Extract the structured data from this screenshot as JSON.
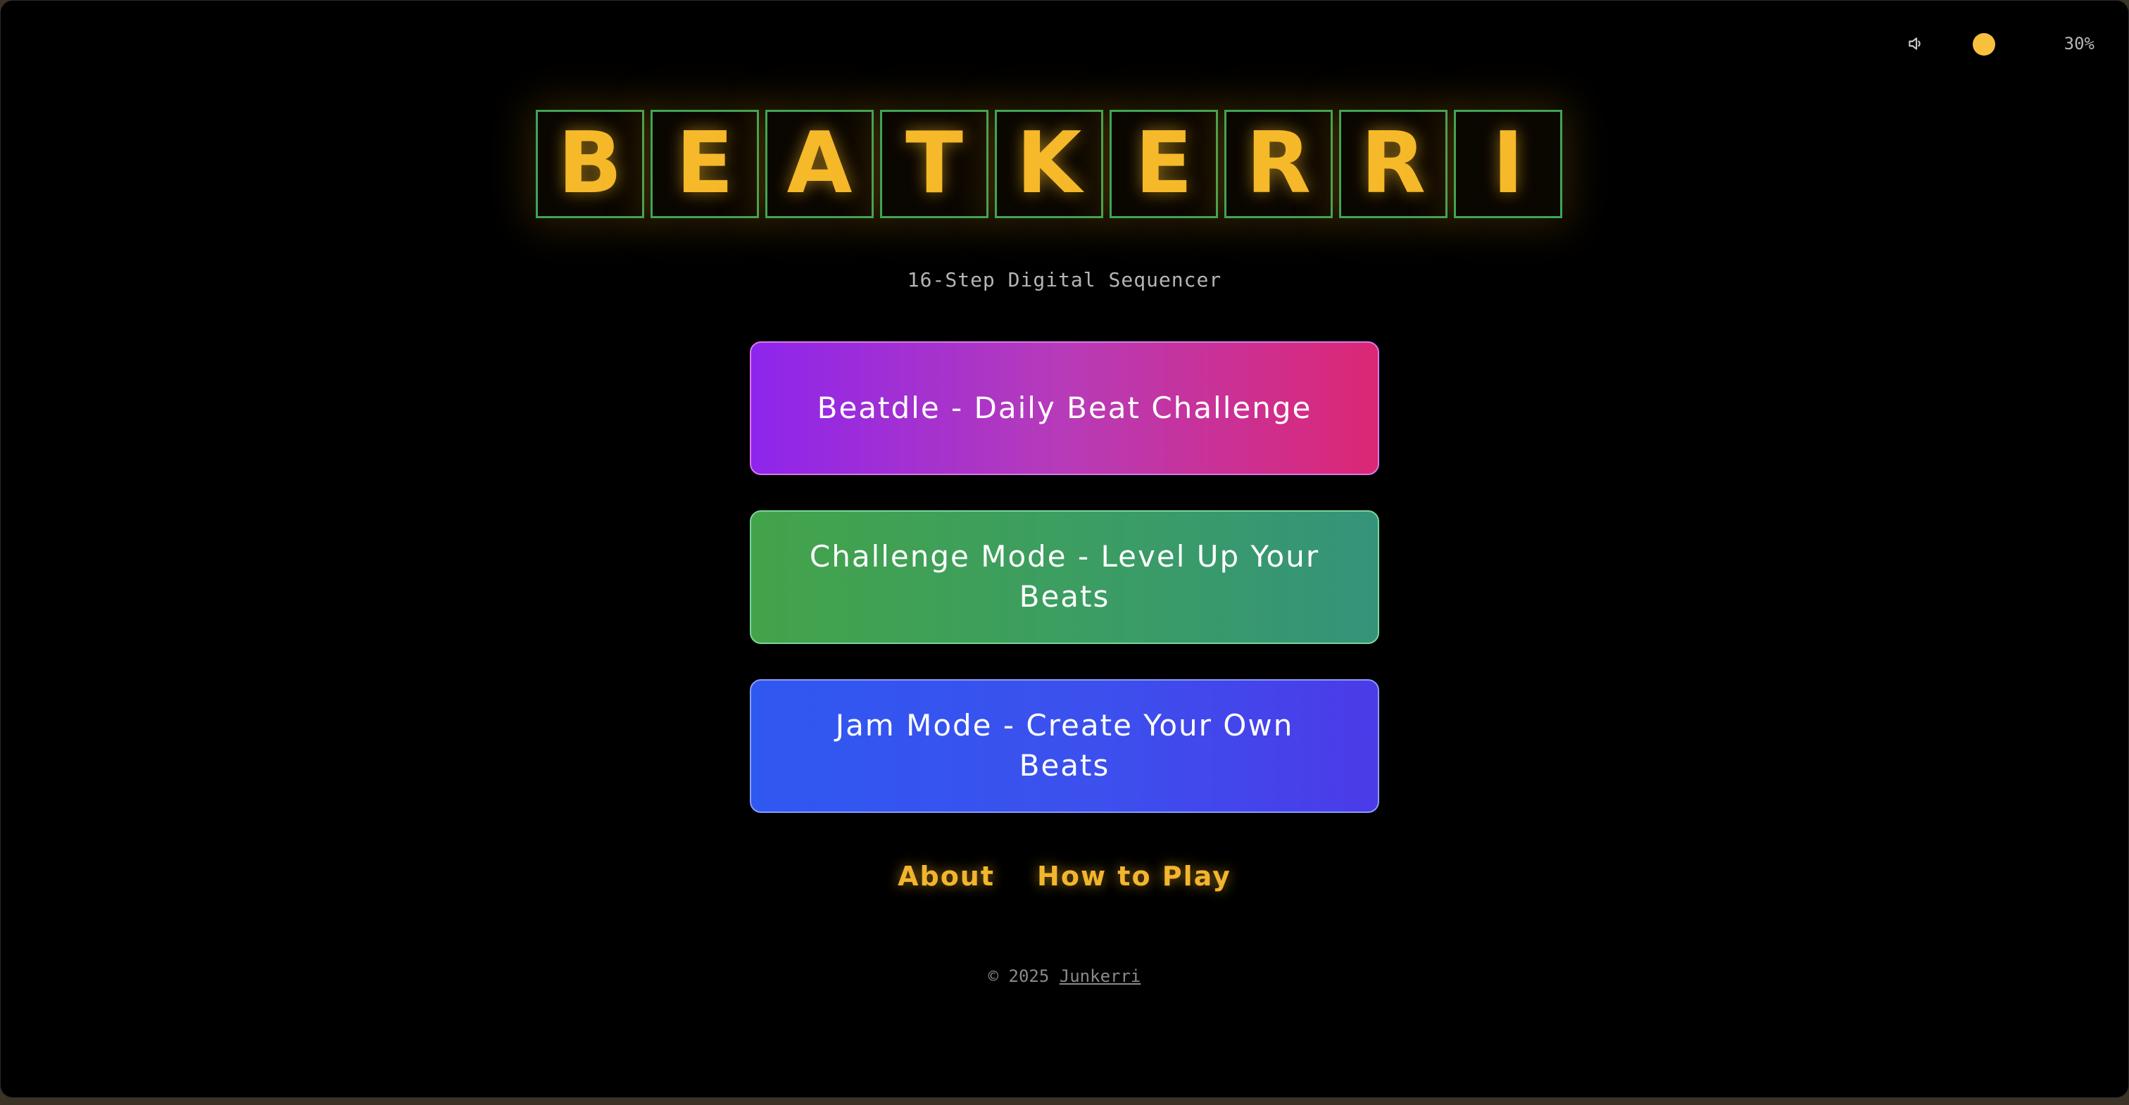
{
  "controls": {
    "volume_icon": "speaker-icon",
    "volume_level": 0.3,
    "volume_percent": "30%"
  },
  "title": {
    "letters": [
      "B",
      "E",
      "A",
      "T",
      "K",
      "E",
      "R",
      "R",
      "I"
    ]
  },
  "subtitle": "16-Step Digital Sequencer",
  "modes": {
    "beatdle": "Beatdle - Daily Beat Challenge",
    "challenge": "Challenge Mode - Level Up Your Beats",
    "jam": "Jam Mode - Create Your Own Beats"
  },
  "links": {
    "about": "About",
    "how_to_play": "How to Play"
  },
  "footer": {
    "copyright": "© 2025",
    "author": "Junkerri"
  },
  "colors": {
    "accent": "#f5b92a",
    "tile_border": "#3fa553",
    "background": "#000000"
  }
}
